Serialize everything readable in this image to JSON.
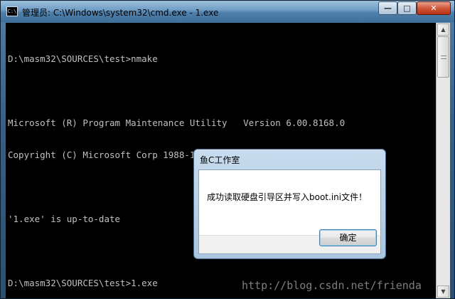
{
  "window": {
    "title": "管理员: C:\\Windows\\system32\\cmd.exe - 1.exe",
    "icon": "C:\\",
    "controls": {
      "minimize": "—",
      "maximize": "□",
      "close": "✕"
    }
  },
  "console": {
    "lines": [
      "D:\\masm32\\SOURCES\\test>nmake",
      "",
      "Microsoft (R) Program Maintenance Utility   Version 6.00.8168.0",
      "Copyright (C) Microsoft Corp 1988-1998. All rights reserved.",
      "",
      "'1.exe' is up-to-date",
      "",
      "D:\\masm32\\SOURCES\\test>1.exe"
    ]
  },
  "scrollbar": {
    "up_arrow": "▲",
    "down_arrow": "▼"
  },
  "dialog": {
    "title": "鱼C工作室",
    "message": "成功读取硬盘引导区并写入boot.ini文件！",
    "ok_label": "确定"
  },
  "watermark": "http://blog.csdn.net/frienda"
}
